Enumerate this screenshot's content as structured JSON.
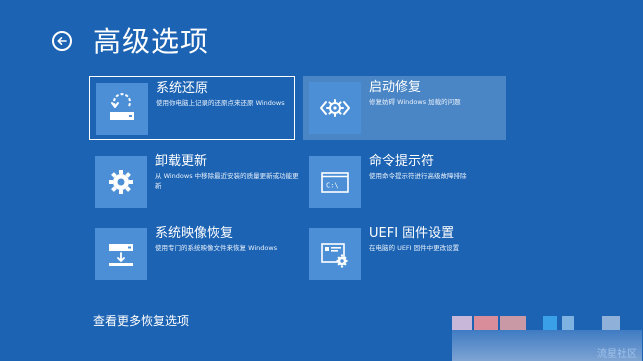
{
  "page": {
    "title": "高级选项",
    "back_icon": "back-arrow-icon",
    "more_link": "查看更多恢复选项",
    "watermark": "流星社区"
  },
  "colors": {
    "background": "#1c63b4",
    "tile": "#4d8fd6",
    "hover_bg": "#4a85c6",
    "text": "#ffffff"
  },
  "options": [
    {
      "title": "系统还原",
      "desc": "使用你电脑上记录的还原点来还原 Windows",
      "icon": "system-restore-icon",
      "state": "focused"
    },
    {
      "title": "启动修复",
      "desc": "修复妨碍 Windows 加载的问题",
      "icon": "startup-repair-icon",
      "state": "hovered"
    },
    {
      "title": "卸载更新",
      "desc": "从 Windows 中移除最近安装的质量更新或功能更新",
      "icon": "gear-icon",
      "state": "normal"
    },
    {
      "title": "命令提示符",
      "desc": "使用命令提示符进行高级故障排除",
      "icon": "command-prompt-icon",
      "state": "normal"
    },
    {
      "title": "系统映像恢复",
      "desc": "使用专门的系统映像文件来恢复 Windows",
      "icon": "system-image-icon",
      "state": "normal"
    },
    {
      "title": "UEFI 固件设置",
      "desc": "在电脑的 UEFI 固件中更改设置",
      "icon": "uefi-firmware-icon",
      "state": "normal"
    }
  ]
}
